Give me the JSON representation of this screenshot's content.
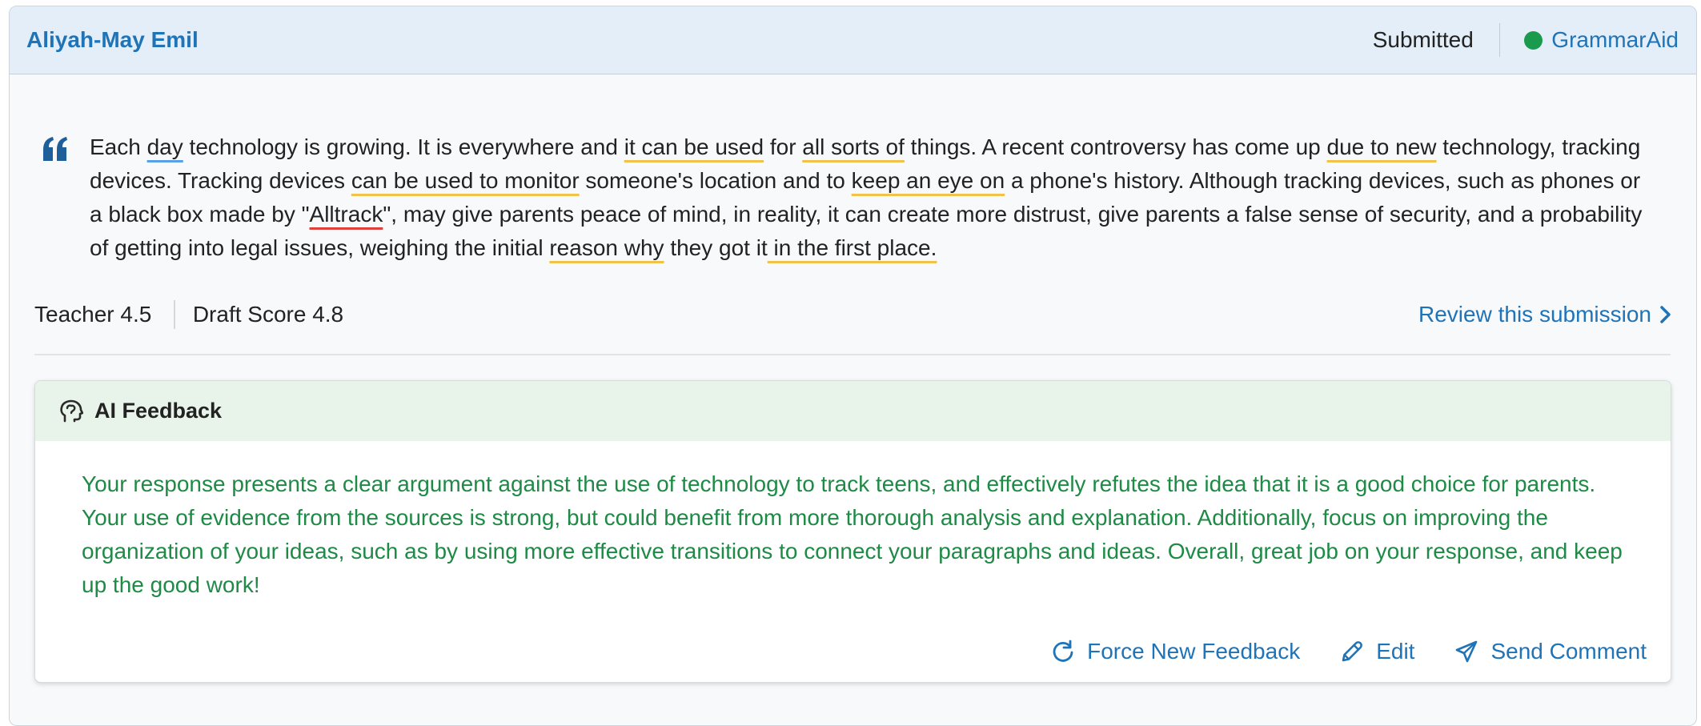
{
  "header": {
    "student_name": "Aliyah-May Emil",
    "status": "Submitted",
    "tool_name": "GrammarAid",
    "tool_status_color": "#1a9a4c"
  },
  "essay": {
    "quote_icon": "quote-icon",
    "segments": [
      {
        "text": "Each ",
        "mark": ""
      },
      {
        "text": "day",
        "mark": "blue"
      },
      {
        "text": " technology is growing. It is everywhere and ",
        "mark": ""
      },
      {
        "text": "it can be used",
        "mark": "yellow"
      },
      {
        "text": " for ",
        "mark": ""
      },
      {
        "text": "all sorts of",
        "mark": "yellow"
      },
      {
        "text": " things. A recent controversy has come up ",
        "mark": ""
      },
      {
        "text": "due to new",
        "mark": "yellow"
      },
      {
        "text": " technology, tracking devices. Tracking devices ",
        "mark": ""
      },
      {
        "text": "can be used to monitor",
        "mark": "yellow"
      },
      {
        "text": " someone's location and to ",
        "mark": ""
      },
      {
        "text": "keep an eye on",
        "mark": "yellow"
      },
      {
        "text": " a phone's history. Although tracking devices, such as phones or a black box made by \"",
        "mark": ""
      },
      {
        "text": "Alltrack",
        "mark": "red"
      },
      {
        "text": "\", may give parents peace of mind, in reality, it can create more distrust, give parents a false sense of security, and a probability of getting into legal issues, weighing the initial ",
        "mark": ""
      },
      {
        "text": "reason why",
        "mark": "yellow"
      },
      {
        "text": " they got it",
        "mark": ""
      },
      {
        "text": " in the first place.",
        "mark": "yellow"
      }
    ]
  },
  "scores": {
    "teacher": "Teacher 4.5",
    "draft": "Draft Score 4.8",
    "review_link": "Review this submission"
  },
  "ai_feedback": {
    "title": "AI Feedback",
    "text": "Your response presents a clear argument against the use of technology to track teens, and effectively refutes the idea that it is a good choice for parents. Your use of evidence from the sources is strong, but could benefit from more thorough analysis and explanation. Additionally, focus on improving the organization of your ideas, such as by using more effective transitions to connect your paragraphs and ideas. Overall, great job on your response, and keep up the good work!",
    "text_color": "#1e8a45",
    "actions": {
      "force_new": "Force New Feedback",
      "edit": "Edit",
      "send_comment": "Send Comment"
    }
  },
  "colors": {
    "link": "#1f73b7",
    "header_bg": "#e3eef8",
    "ai_header_bg": "#e8f4ea"
  }
}
